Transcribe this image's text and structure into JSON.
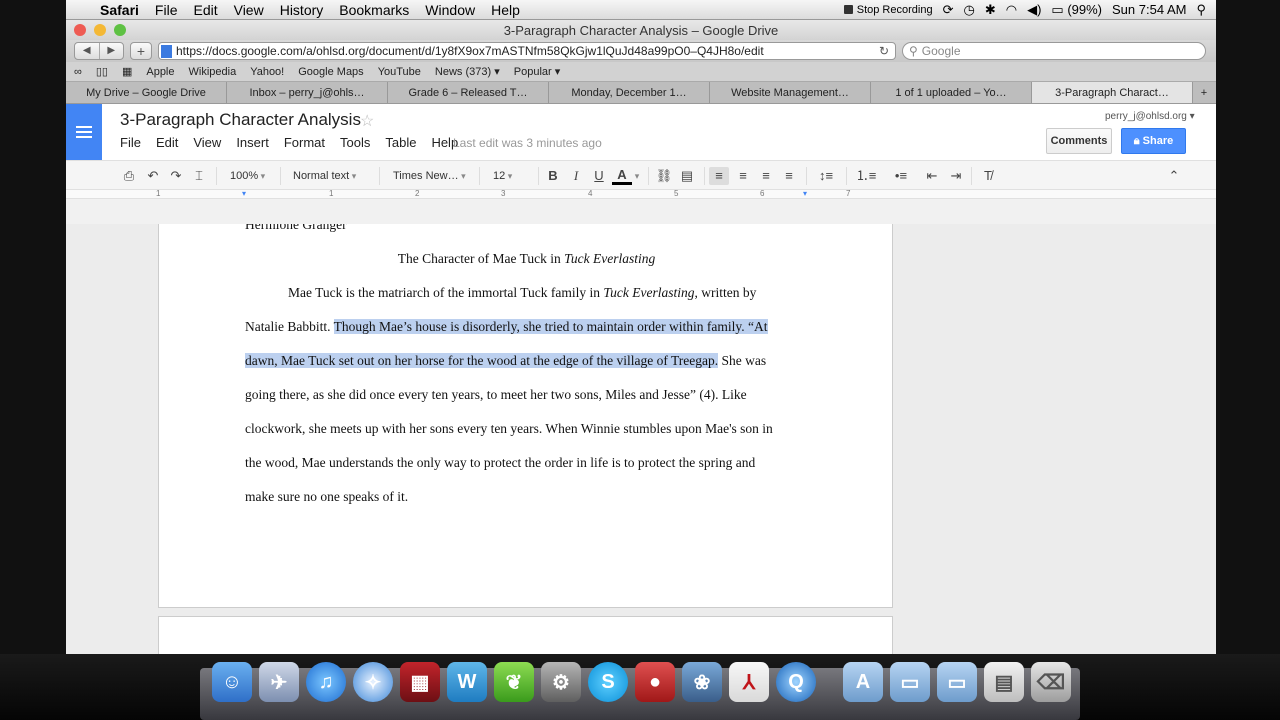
{
  "menubar": {
    "apple": "",
    "items": [
      "Safari",
      "File",
      "Edit",
      "View",
      "History",
      "Bookmarks",
      "Window",
      "Help"
    ],
    "recording": "Stop Recording",
    "battery": "(99%)",
    "clock": "Sun 7:54 AM"
  },
  "window": {
    "title": "3-Paragraph Character Analysis – Google Drive",
    "url": "https://docs.google.com/a/ohlsd.org/document/d/1y8fX9ox7mASTNfm58QkGjw1lQuJd48a99pO0–Q4JH8o/edit",
    "search_placeholder": "Google"
  },
  "bookmarks": [
    "Apple",
    "Wikipedia",
    "Yahoo!",
    "Google Maps",
    "YouTube",
    "News (373) ▾",
    "Popular ▾"
  ],
  "tabs": [
    "My Drive – Google Drive",
    "Inbox – perry_j@ohls…",
    "Grade 6 – Released T…",
    "Monday, December 1…",
    "Website Management…",
    "1 of 1 uploaded – Yo…",
    "3-Paragraph Charact…"
  ],
  "docs": {
    "title": "3-Paragraph Character Analysis",
    "menu": [
      "File",
      "Edit",
      "View",
      "Insert",
      "Format",
      "Tools",
      "Table",
      "Help"
    ],
    "last_edit": "Last edit was 3 minutes ago",
    "user": "perry_j@ohlsd.org",
    "comments": "Comments",
    "share": "Share"
  },
  "toolbar": {
    "zoom": "100%",
    "style": "Normal text",
    "font": "Times New…",
    "size": "12",
    "bold": "B",
    "italic": "I",
    "underline": "U",
    "text_color": "A"
  },
  "ruler": [
    "1",
    "1",
    "2",
    "3",
    "4",
    "5",
    "6",
    "7"
  ],
  "document": {
    "name_line": "Hermione Granger",
    "heading_plain": "The Character of Mae Tuck in ",
    "heading_italic": "Tuck Everlasting",
    "lines": [
      {
        "a": "Mae Tuck is the matriarch of the immortal Tuck family in ",
        "i": "Tuck Everlasting",
        "b": ", written by"
      },
      {
        "a": "Natalie Babbitt.  ",
        "h": "Though Mae’s house is disorderly, she tried to maintain order within family.  “At"
      },
      {
        "h": "dawn, Mae Tuck set out on her horse for the wood at the edge of the village of Treegap.",
        "a": " She was"
      },
      {
        "a": "going there, as she did once every ten years, to meet her two sons, Miles and Jesse” (4).  Like"
      },
      {
        "a": "clockwork, she meets up with her sons every ten years. When Winnie stumbles upon Mae's son in"
      },
      {
        "a": "the wood, Mae understands the only way to protect the order in life is to protect the spring and"
      },
      {
        "a": "make sure no one speaks of it."
      }
    ]
  },
  "colors": {
    "docs_blue": "#4285f4",
    "share_blue": "#4d90fe",
    "selection": "#bcd0ef"
  },
  "dock": [
    "finder-icon",
    "preview-icon",
    "itunes-icon",
    "safari-icon",
    "photo-booth-icon",
    "wunderlist-icon",
    "evernote-icon",
    "system-preferences-icon",
    "skype-icon",
    "angry-birds-icon",
    "iphoto-icon",
    "acrobat-icon",
    "quicktime-icon",
    "applications-folder-icon",
    "documents-folder-icon",
    "downloads-folder-icon",
    "screenshot-icon",
    "trash-icon"
  ]
}
